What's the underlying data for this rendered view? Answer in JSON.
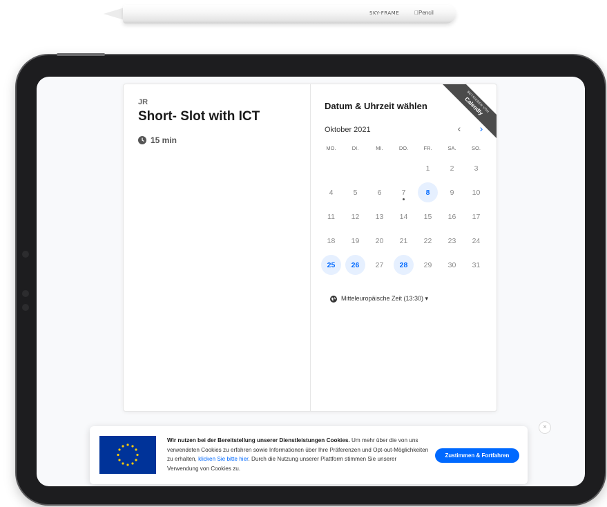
{
  "pencil": {
    "brand": "SKY-FRAME",
    "label": "Pencil"
  },
  "event": {
    "host_initials": "JR",
    "title": "Short- Slot with ICT",
    "duration": "15 min",
    "duration_icon": "clock-icon"
  },
  "calendar": {
    "heading": "Datum & Uhrzeit wählen",
    "month": "Oktober 2021",
    "prev_icon": "chevron-left-icon",
    "next_icon": "chevron-right-icon",
    "weekdays": [
      "MO.",
      "DI.",
      "MI.",
      "DO.",
      "FR.",
      "SA.",
      "SO."
    ],
    "weeks": [
      [
        "",
        "",
        "",
        "",
        "1",
        "2",
        "3"
      ],
      [
        "4",
        "5",
        "6",
        "7",
        "8",
        "9",
        "10"
      ],
      [
        "11",
        "12",
        "13",
        "14",
        "15",
        "16",
        "17"
      ],
      [
        "18",
        "19",
        "20",
        "21",
        "22",
        "23",
        "24"
      ],
      [
        "25",
        "26",
        "27",
        "28",
        "29",
        "30",
        "31"
      ]
    ],
    "available_days": [
      "8",
      "25",
      "26",
      "28"
    ],
    "today": "7",
    "accent_color": "#0069ff",
    "timezone": "Mitteleuropäische Zeit (13:30) ▾"
  },
  "ribbon": {
    "top": "BETRIEBEN VON",
    "brand": "Calendly"
  },
  "cookie": {
    "bold": "Wir nutzen bei der Bereitstellung unserer Dienstleistungen Cookies.",
    "text1": " Um mehr über die von uns verwendeten Cookies zu erfahren sowie Informationen über Ihre Präferenzen und Opt-out-Möglichkeiten zu erhalten, ",
    "link": "klicken Sie bitte hier",
    "text2": ". Durch die Nutzung unserer Plattform stimmen Sie unserer Verwendung von Cookies zu.",
    "accept": "Zustimmen & Fortfahren",
    "close": "×"
  }
}
